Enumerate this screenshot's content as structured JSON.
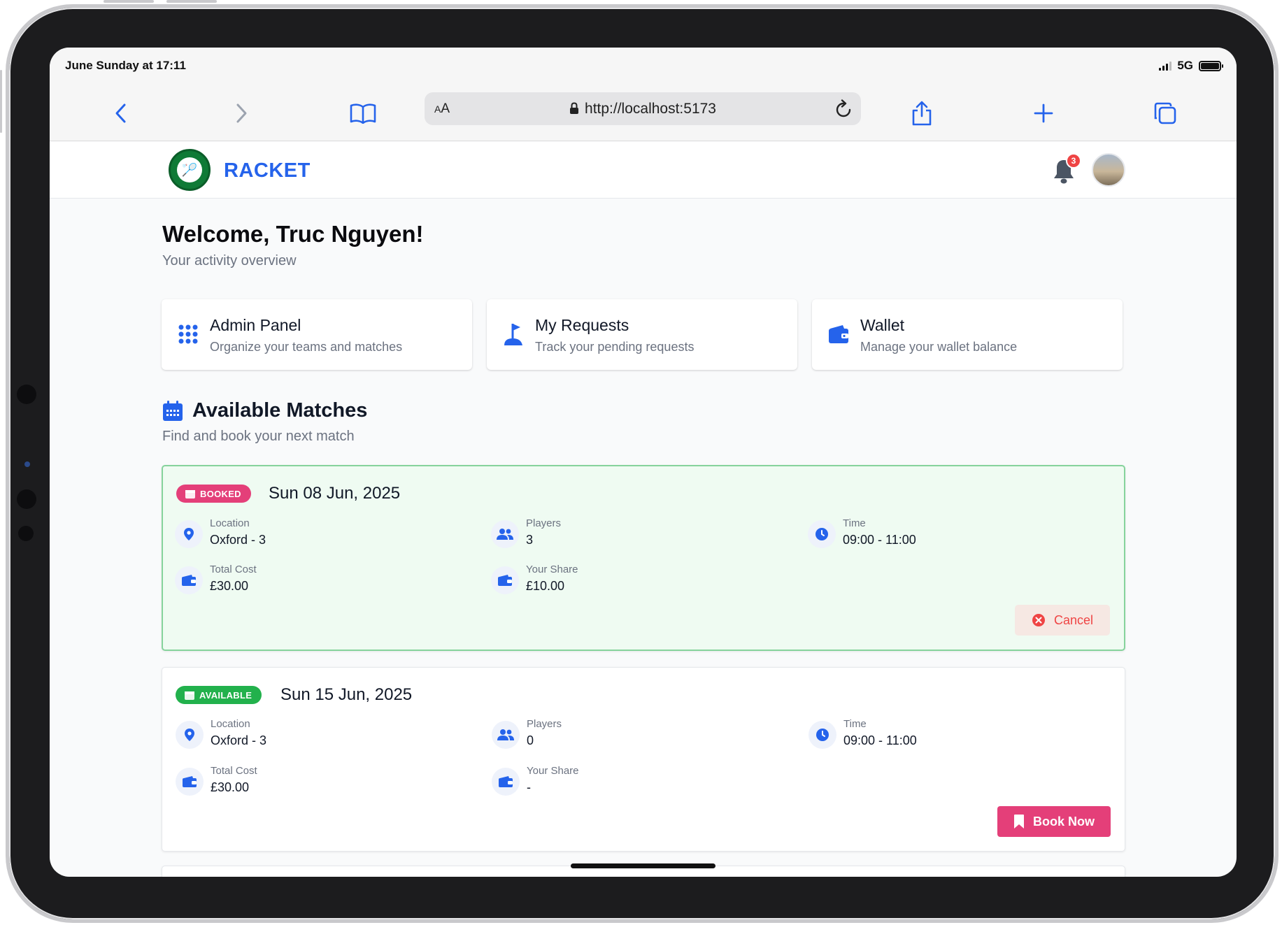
{
  "status_bar": {
    "time": "June Sunday at 17:11",
    "network": "5G"
  },
  "browser": {
    "aa_label": "AA",
    "url": "http://localhost:5173"
  },
  "header": {
    "brand": "RACKET",
    "notification_count": "3"
  },
  "main": {
    "welcome": "Welcome, Truc Nguyen!",
    "subtitle": "Your activity overview",
    "quick_links": [
      {
        "title": "Admin Panel",
        "subtitle": "Organize your teams and matches",
        "icon": "grid-icon"
      },
      {
        "title": "My Requests",
        "subtitle": "Track your pending requests",
        "icon": "flag-icon"
      },
      {
        "title": "Wallet",
        "subtitle": "Manage your wallet balance",
        "icon": "wallet-icon"
      }
    ],
    "matches_section": {
      "title": "Available Matches",
      "subtitle": "Find and book your next match"
    },
    "matches": [
      {
        "status": "BOOKED",
        "date": "Sun 08 Jun, 2025",
        "location_label": "Location",
        "location": "Oxford - 3",
        "players_label": "Players",
        "players": "3",
        "time_label": "Time",
        "time": "09:00 - 11:00",
        "total_cost_label": "Total Cost",
        "total_cost": "£30.00",
        "share_label": "Your Share",
        "share": "£10.00",
        "action": "Cancel"
      },
      {
        "status": "AVAILABLE",
        "date": "Sun 15 Jun, 2025",
        "location_label": "Location",
        "location": "Oxford - 3",
        "players_label": "Players",
        "players": "0",
        "time_label": "Time",
        "time": "09:00 - 11:00",
        "total_cost_label": "Total Cost",
        "total_cost": "£30.00",
        "share_label": "Your Share",
        "share": "-",
        "action": "Book Now"
      }
    ]
  },
  "colors": {
    "accent": "#2563eb",
    "booked": "#e43f79",
    "available": "#22b14c",
    "danger": "#ef4444"
  }
}
